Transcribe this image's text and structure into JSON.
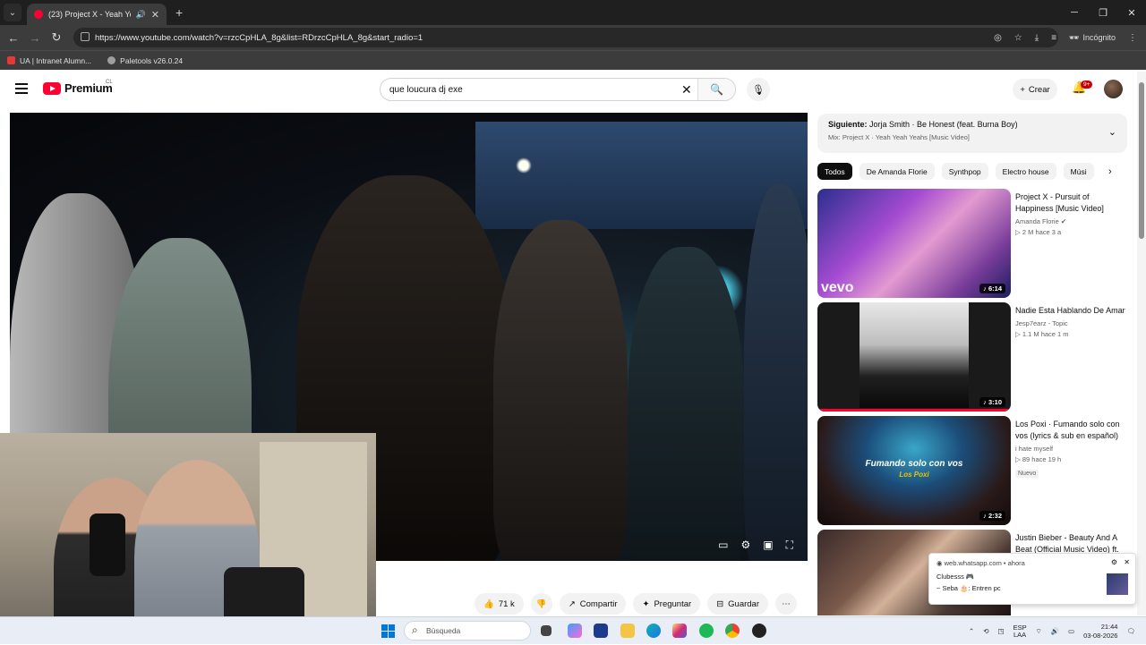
{
  "browser": {
    "tab_title": "(23) Project X - Yeah Yeah Y",
    "url": "https://www.youtube.com/watch?v=rzcCpHLA_8g&list=RDrzcCpHLA_8g&start_radio=1",
    "incognito_label": "Incógnito",
    "bookmarks": [
      {
        "label": "UA | Intranet Alumn...",
        "color": "#e53935"
      },
      {
        "label": "Paletools v26.0.24",
        "color": "#9e9e9e"
      }
    ]
  },
  "youtube": {
    "logo_text": "Premium",
    "logo_suffix": "CL",
    "search_value": "que loucura dj exe",
    "create_label": "Crear",
    "notifications_count": "9+"
  },
  "player": {
    "actions": {
      "likes": "71 k",
      "share": "Compartir",
      "ask": "Preguntar",
      "save": "Guardar"
    }
  },
  "up_next": {
    "prefix": "Siguiente:",
    "title": "Jorja Smith · Be Honest (feat. Burna Boy)",
    "mix": "Mix: Project X · Yeah Yeah Yeahs [Music Video]"
  },
  "chips": [
    "Todos",
    "De Amanda Florie",
    "Synthpop",
    "Electro house",
    "Músi"
  ],
  "recommendations": [
    {
      "title": "Project X - Pursuit of Happiness [Music Video]",
      "channel": "Amanda Florie ✔",
      "meta": "▷ 2 M  hace 3 a",
      "duration": "♪ 6:14",
      "badge": ""
    },
    {
      "title": "Nadie Esta Hablando De Amar",
      "channel": "Jesp7earz - Topic",
      "meta": "▷ 1.1 M  hace 1 m",
      "duration": "♪ 3:10",
      "badge": ""
    },
    {
      "title": "Los Poxi · Fumando solo con vos (lyrics & sub en español)",
      "channel": "i hate myself",
      "meta": "▷ 89  hace 19 h",
      "duration": "♪ 2:32",
      "badge": "Nuevo",
      "overlay1": "Fumando solo con vos",
      "overlay2": "Los Poxi"
    },
    {
      "title": "Justin Bieber - Beauty And A Beat (Official Music Video) ft.",
      "channel": "",
      "meta": "",
      "duration": "",
      "badge": ""
    }
  ],
  "notification": {
    "source": "web.whatsapp.com  •  ahora",
    "line1": "Clubesss 🎮",
    "line2": "~ Seba 🎂: Entren pc"
  },
  "taskbar": {
    "search_placeholder": "Búsqueda",
    "lang": "ESP\nLAA",
    "time": "21:44",
    "date": "03-08-2026"
  }
}
